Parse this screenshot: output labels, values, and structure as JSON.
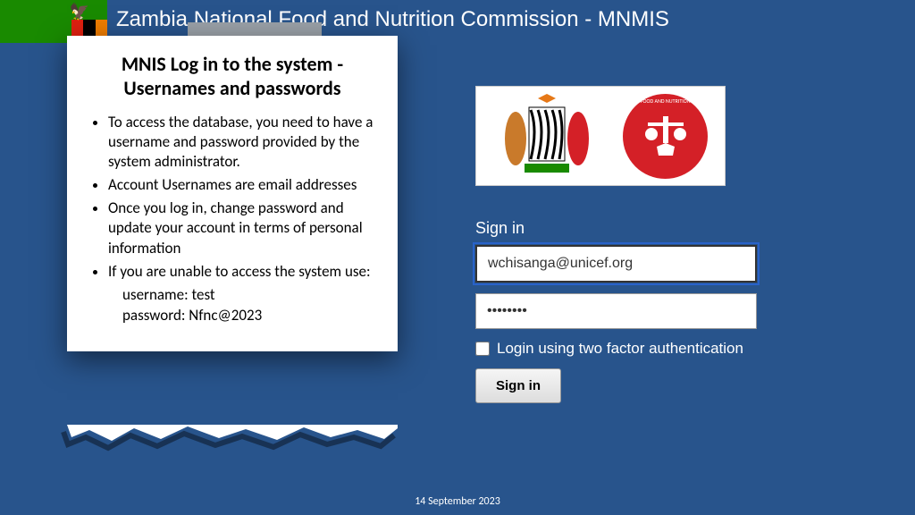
{
  "header": {
    "title": "Zambia National Food and Nutrition Commission - MNMIS"
  },
  "paper": {
    "heading": "MNIS Log in to the system - Usernames and passwords",
    "bullets": [
      "To access the database, you need to have a username and password provided by the system administrator.",
      "Account Usernames are email addresses",
      "Once you log in, change password and update your account in terms of personal information",
      "If you are unable to access the system use:"
    ],
    "fallback_user": "username: test",
    "fallback_pass": "password: Nfnc@2023"
  },
  "logos": {
    "nutrition_label": "FOOD AND NUTRITION"
  },
  "signin": {
    "title": "Sign in",
    "username_value": "wchisanga@unicef.org",
    "password_value": "••••••••",
    "checkbox_label": "Login using two factor authentication",
    "button_label": "Sign in"
  },
  "footer": {
    "date": "14 September 2023"
  }
}
